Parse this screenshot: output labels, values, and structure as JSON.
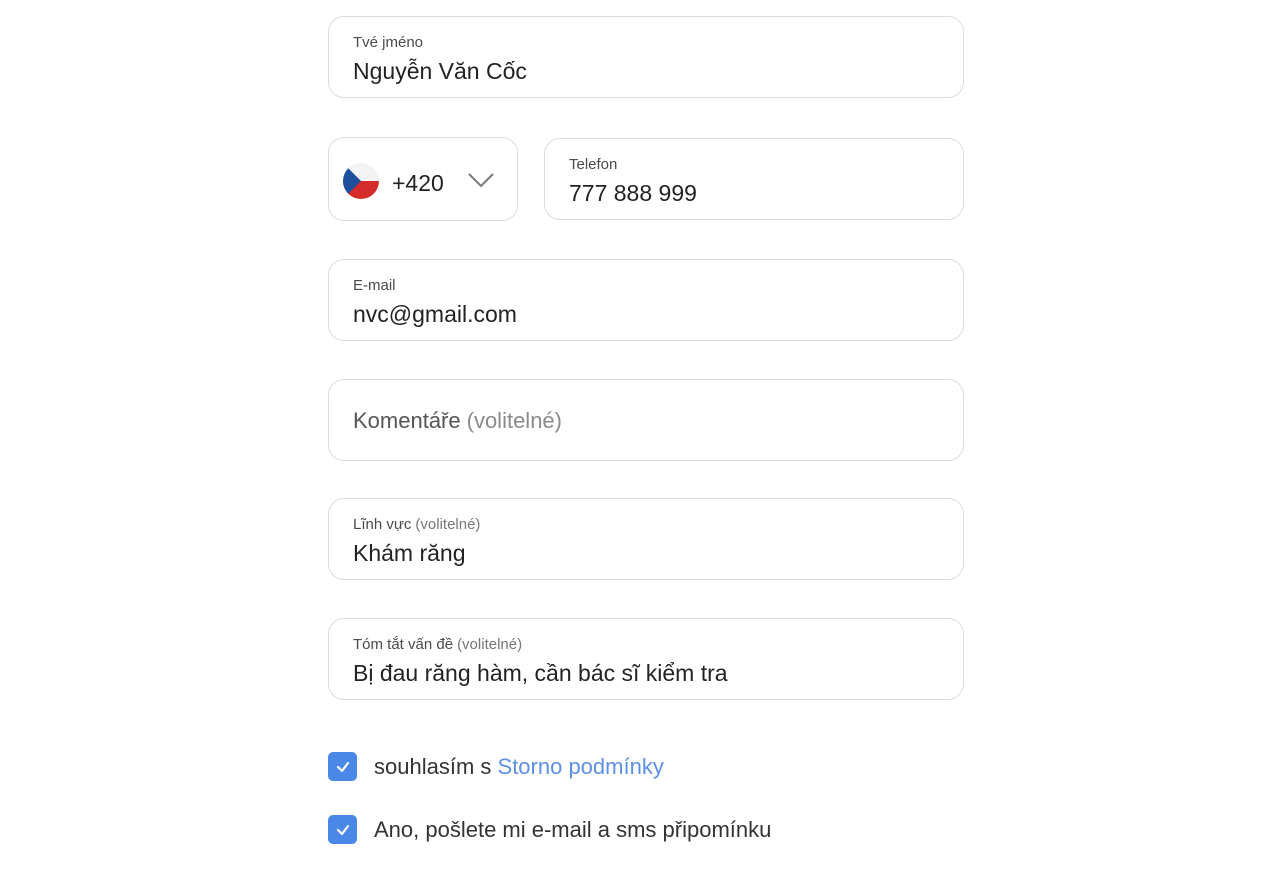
{
  "form": {
    "name": {
      "label": "Tvé jméno",
      "value": "Nguyễn Văn Cốc"
    },
    "phone": {
      "country_code": "+420",
      "country_flag_icon": "czech-flag-icon",
      "label": "Telefon",
      "value": "777 888 999"
    },
    "email": {
      "label": "E-mail",
      "value": "nvc@gmail.com"
    },
    "comment": {
      "placeholder": "Komentáře",
      "optional": "(volitelné)"
    },
    "field": {
      "label": "Lĩnh vực",
      "optional": "(volitelné)",
      "value": "Khám răng"
    },
    "summary": {
      "label": "Tóm tắt vấn đề",
      "optional": "(volitelné)",
      "value": "Bị đau răng hàm, cần bác sĩ kiểm tra"
    }
  },
  "consent": {
    "terms_prefix": "souhlasím s",
    "terms_link": "Storno podmínky",
    "terms_checked": true,
    "reminder_label": "Ano, pošlete mi e-mail a sms připomínku",
    "reminder_checked": true
  },
  "colors": {
    "accent": "#4a88e8",
    "link": "#5d8fe4",
    "border": "#dcdcdc"
  }
}
